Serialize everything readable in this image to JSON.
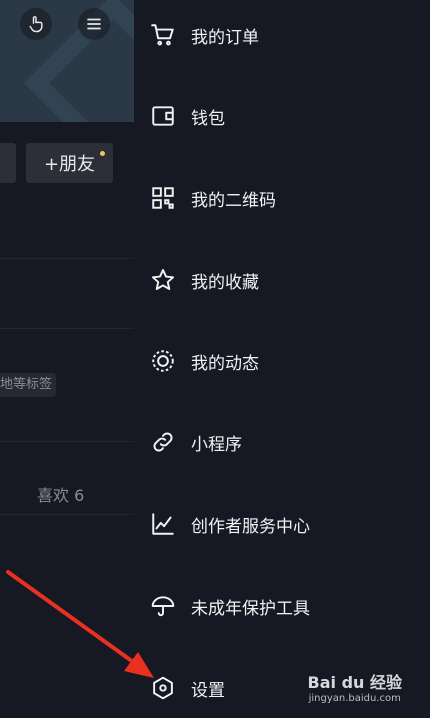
{
  "left_panel": {
    "friend_button_label": "+朋友",
    "tag_text": "地等标签",
    "likes_text": "喜欢 6"
  },
  "menu": {
    "items": [
      {
        "label": "我的订单",
        "icon": "cart-icon"
      },
      {
        "label": "钱包",
        "icon": "wallet-icon"
      },
      {
        "label": "我的二维码",
        "icon": "qr-code-icon"
      },
      {
        "label": "我的收藏",
        "icon": "star-icon"
      },
      {
        "label": "我的动态",
        "icon": "activity-icon"
      },
      {
        "label": "小程序",
        "icon": "link-icon"
      },
      {
        "label": "创作者服务中心",
        "icon": "chart-icon"
      },
      {
        "label": "未成年保护工具",
        "icon": "umbrella-icon"
      },
      {
        "label": "设置",
        "icon": "settings-icon"
      }
    ]
  },
  "watermark": {
    "brand": "Bai du 经验",
    "url": "jingyan.baidu.com"
  },
  "colors": {
    "background": "#161823",
    "text": "#f2f2f3",
    "muted": "#8b8c93",
    "accent_dot": "#f2c94c",
    "arrow": "#e8321f"
  }
}
